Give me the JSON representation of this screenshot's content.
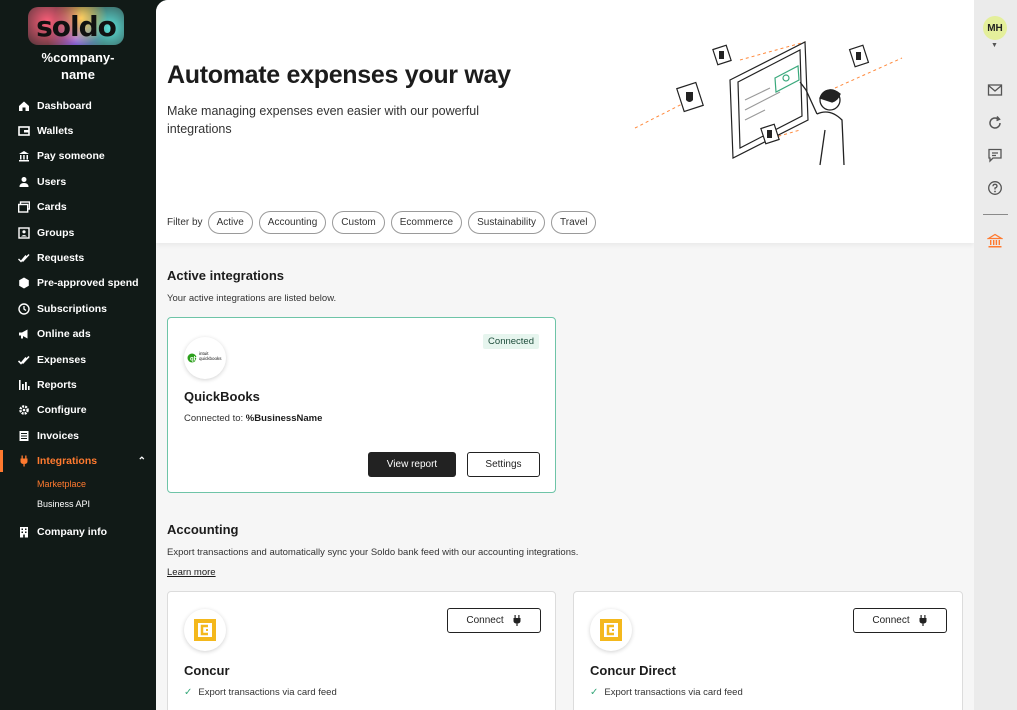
{
  "brand": {
    "logo_text": "soldo",
    "company_name": "%company-name"
  },
  "sidebar": {
    "items": [
      {
        "label": "Dashboard",
        "icon": "home-icon"
      },
      {
        "label": "Wallets",
        "icon": "wallet-icon"
      },
      {
        "label": "Pay someone",
        "icon": "pay-icon"
      },
      {
        "label": "Users",
        "icon": "user-icon"
      },
      {
        "label": "Cards",
        "icon": "cards-icon"
      },
      {
        "label": "Groups",
        "icon": "groups-icon"
      },
      {
        "label": "Requests",
        "icon": "requests-icon"
      },
      {
        "label": "Pre-approved spend",
        "icon": "pre-approved-icon"
      },
      {
        "label": "Subscriptions",
        "icon": "subscriptions-icon"
      },
      {
        "label": "Online ads",
        "icon": "megaphone-icon"
      },
      {
        "label": "Expenses",
        "icon": "expenses-check-icon"
      },
      {
        "label": "Reports",
        "icon": "reports-icon"
      },
      {
        "label": "Configure",
        "icon": "gear-icon"
      },
      {
        "label": "Invoices",
        "icon": "invoices-icon"
      },
      {
        "label": "Integrations",
        "icon": "plug-icon",
        "active": true
      }
    ],
    "sub_items": [
      {
        "label": "Marketplace",
        "active": true
      },
      {
        "label": "Business API"
      }
    ],
    "company_info": "Company info"
  },
  "hero": {
    "title": "Automate expenses your way",
    "subtitle": "Make managing expenses even easier with our powerful integrations"
  },
  "filters": {
    "label": "Filter by",
    "chips": [
      "Active",
      "Accounting",
      "Custom",
      "Ecommerce",
      "Sustainability",
      "Travel"
    ]
  },
  "active_section": {
    "title": "Active integrations",
    "subtitle": "Your active integrations are listed below.",
    "card": {
      "badge": "Connected",
      "logo_text": "intuit quickbooks",
      "name": "QuickBooks",
      "connected_label": "Connected to:",
      "connected_value": "%BusinessName",
      "view_report": "View report",
      "settings": "Settings"
    }
  },
  "accounting_section": {
    "title": "Accounting",
    "subtitle": "Export transactions and automatically sync your Soldo bank feed with our accounting integrations.",
    "learn_more": "Learn more",
    "cards": [
      {
        "name": "Concur",
        "connect": "Connect",
        "feature": "Export transactions via card feed"
      },
      {
        "name": "Concur Direct",
        "connect": "Connect",
        "feature": "Export transactions via card feed"
      }
    ]
  },
  "rail": {
    "avatar_initials": "MH"
  },
  "colors": {
    "accent": "#ff7a2f",
    "sidebar_bg": "#111a17",
    "connected_border": "#6ec4a7",
    "concur_yellow": "#f4b81c"
  }
}
